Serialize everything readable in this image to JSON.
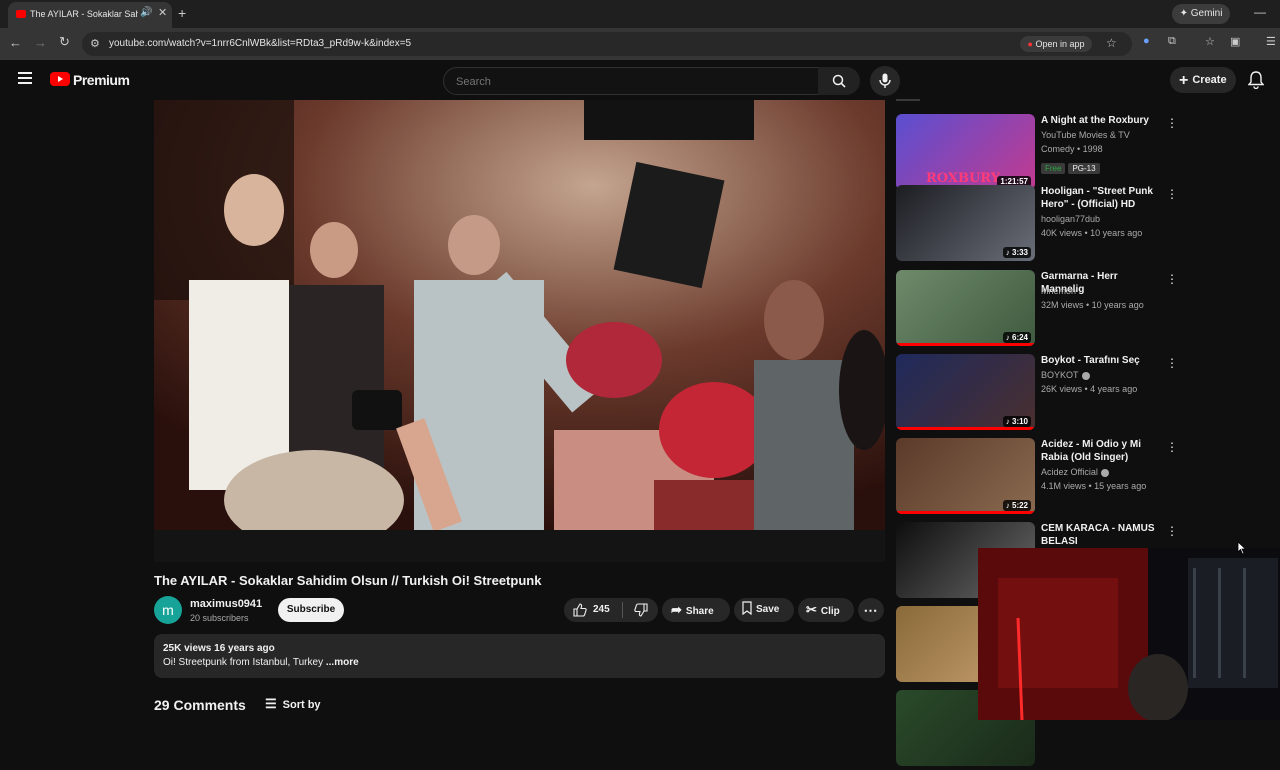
{
  "browser": {
    "tab_title": "The AYILAR - Sokaklar Sahidim Olsun // Turkish Oi! Streetpunk",
    "gemini_label": "Gemini",
    "url": "youtube.com/watch?v=1nrr6CnlWBk&list=RDta3_pRd9w-k&index=5",
    "open_in_app": "Open in app"
  },
  "header": {
    "brand": "Premium",
    "search_placeholder": "Search",
    "create_label": "Create"
  },
  "video": {
    "title": "The AYILAR - Sokaklar Sahidim Olsun // Turkish Oi! Streetpunk",
    "channel_initial": "m",
    "channel_name": "maximus0941",
    "subscribers": "20 subscribers",
    "subscribe_label": "Subscribe",
    "likes": "245",
    "share_label": "Share",
    "save_label": "Save",
    "clip_label": "Clip",
    "stats": "25K views  16 years ago",
    "description": "Oi! Streetpunk from Istanbul, Turkey",
    "more_label": "...more",
    "comments_count": "29 Comments",
    "sort_label": "Sort by"
  },
  "recommendations": [
    {
      "title": "A Night at the Roxbury",
      "channel": "YouTube Movies & TV",
      "meta": "Comedy • 1998",
      "badges": [
        "Free",
        "PG-13"
      ],
      "duration": "1:21:57",
      "thumb_text": "ROXBURY",
      "colors": [
        "#5a4fd1",
        "#c23a8f"
      ]
    },
    {
      "title": "Hooligan - \"Street Punk Hero\" - (Official) HD",
      "channel": "hooligan77dub",
      "meta": "40K views • 10 years ago",
      "duration": "♪ 3:33",
      "colors": [
        "#1b1d22",
        "#6a6e78"
      ]
    },
    {
      "title": "Garmarna - Herr Mannelig",
      "channel": "Mnemon",
      "meta": "32M views • 10 years ago",
      "duration": "♪ 6:24",
      "colors": [
        "#6e8a6a",
        "#3f5a3f"
      ],
      "progress": 1.0
    },
    {
      "title": "Boykot - Tarafını Seç",
      "channel": "BOYKOT",
      "meta": "26K views • 4 years ago",
      "duration": "♪ 3:10",
      "colors": [
        "#1f2a5c",
        "#4a2f2f"
      ],
      "progress": 1.0,
      "verified": true
    },
    {
      "title": "Acidez - Mi Odio y Mi Rabia (Old Singer)",
      "channel": "Acidez Official",
      "meta": "4.1M views • 15 years ago",
      "duration": "♪ 5:22",
      "colors": [
        "#5b3a2a",
        "#8a6a4f"
      ],
      "progress": 1.0,
      "verified": true
    },
    {
      "title": "CEM KARACA - NAMUS BELASI",
      "colors": [
        "#0e0e0e",
        "#6a6a6a"
      ]
    },
    {
      "title": "",
      "colors": [
        "#8a6a3a",
        "#c8a070"
      ]
    },
    {
      "title": "",
      "colors": [
        "#2a4a2a",
        "#1a2a1a"
      ]
    }
  ]
}
